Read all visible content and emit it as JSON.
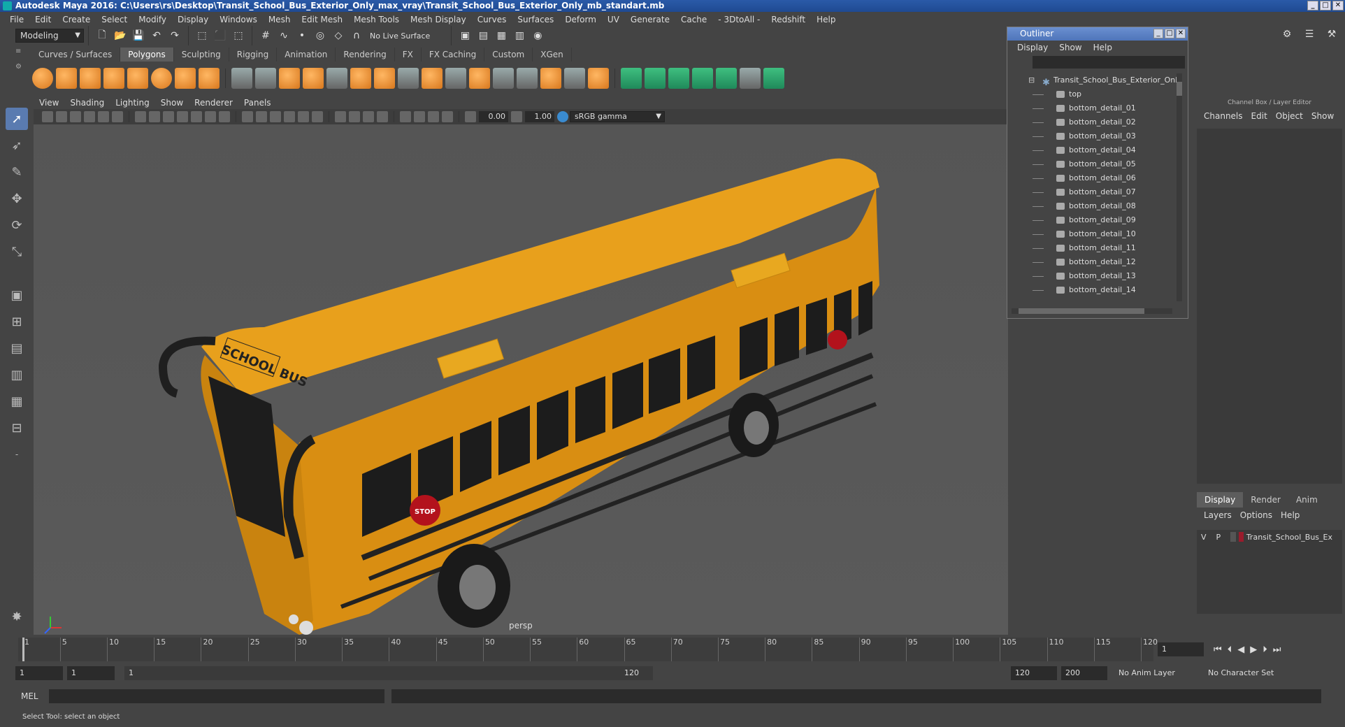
{
  "window": {
    "title": "Autodesk Maya 2016: C:\\Users\\rs\\Desktop\\Transit_School_Bus_Exterior_Only_max_vray\\Transit_School_Bus_Exterior_Only_mb_standart.mb"
  },
  "menubar": [
    "File",
    "Edit",
    "Create",
    "Select",
    "Modify",
    "Display",
    "Windows",
    "Mesh",
    "Edit Mesh",
    "Mesh Tools",
    "Mesh Display",
    "Curves",
    "Surfaces",
    "Deform",
    "UV",
    "Generate",
    "Cache",
    "- 3DtoAll -",
    "Redshift",
    "Help"
  ],
  "status": {
    "mode": "Modeling",
    "live_surface": "No Live Surface"
  },
  "shelf_tabs": [
    "Curves / Surfaces",
    "Polygons",
    "Sculpting",
    "Rigging",
    "Animation",
    "Rendering",
    "FX",
    "FX Caching",
    "Custom",
    "XGen"
  ],
  "viewport": {
    "menu": [
      "View",
      "Shading",
      "Lighting",
      "Show",
      "Renderer",
      "Panels"
    ],
    "exposure": "0.00",
    "gamma": "1.00",
    "color_space": "sRGB gamma",
    "camera_label": "persp",
    "bus_sign": "SCHOOL BUS",
    "stop_sign": "STOP",
    "bus_color": "#e49a16"
  },
  "outliner": {
    "title": "Outliner",
    "menu": [
      "Display",
      "Show",
      "Help"
    ],
    "root": "Transit_School_Bus_Exterior_Only",
    "items": [
      "top",
      "bottom_detail_01",
      "bottom_detail_02",
      "bottom_detail_03",
      "bottom_detail_04",
      "bottom_detail_05",
      "bottom_detail_06",
      "bottom_detail_07",
      "bottom_detail_08",
      "bottom_detail_09",
      "bottom_detail_10",
      "bottom_detail_11",
      "bottom_detail_12",
      "bottom_detail_13",
      "bottom_detail_14"
    ]
  },
  "channel_box": {
    "title": "Channel Box / Layer Editor",
    "menu": [
      "Channels",
      "Edit",
      "Object",
      "Show"
    ],
    "layer_tabs": [
      "Display",
      "Render",
      "Anim"
    ],
    "layer_menu": [
      "Layers",
      "Options",
      "Help"
    ],
    "layer": {
      "v": "V",
      "p": "P",
      "name": "Transit_School_Bus_Ex",
      "color": "#9a1b2c"
    }
  },
  "timeline": {
    "ticks": [
      "1",
      "5",
      "10",
      "15",
      "20",
      "25",
      "30",
      "35",
      "40",
      "45",
      "50",
      "55",
      "60",
      "65",
      "70",
      "75",
      "80",
      "85",
      "90",
      "95",
      "100",
      "105",
      "110",
      "115",
      "120"
    ],
    "current_frame": "1"
  },
  "range": {
    "start": "1",
    "anim_start": "1",
    "slider_start": "1",
    "slider_end": "120",
    "end": "120",
    "anim_end": "200",
    "anim_layer": "No Anim Layer",
    "char_set": "No Character Set"
  },
  "mel_label": "MEL",
  "help_line": "Select Tool: select an object"
}
